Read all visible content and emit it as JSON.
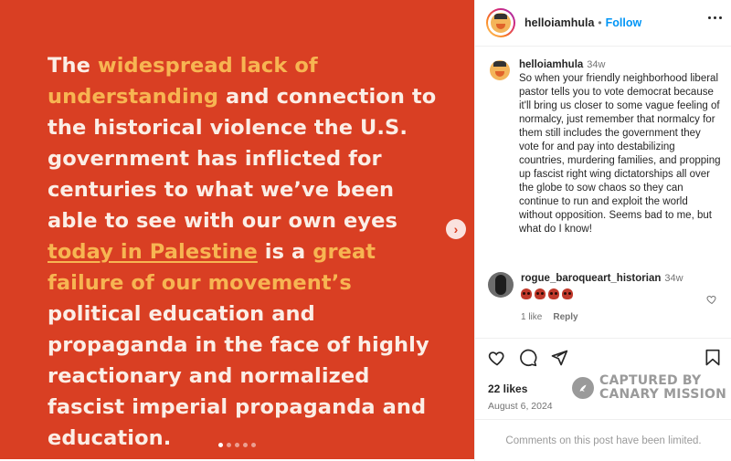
{
  "media": {
    "text": {
      "p1": "The ",
      "p2": "widespread lack of understanding",
      "p3": " and connection to the historical violence the U.S. government has inflicted for centuries to what we’ve been able to see with our own eyes ",
      "p4": "today in Palestine",
      "p5": " is a ",
      "p6": "great failure of our movement’s",
      "p7": " political education and propaganda in the face of highly reactionary and normalized fascist imperial propaganda and education."
    },
    "background_color": "#d93f23",
    "highlight_color": "#f7b552",
    "next_icon": "chevron-right-icon",
    "carousel": {
      "total": 5,
      "active": 1
    }
  },
  "header": {
    "username": "helloiamhula",
    "separator": "•",
    "follow_label": "Follow",
    "more_icon": "more-horizontal-icon"
  },
  "caption": {
    "username": "helloiamhula",
    "time": "34w",
    "text": "So when your friendly neighborhood liberal pastor tells you to vote democrat because it'll bring us closer to some vague feeling of normalcy, just remember that normalcy for them still includes the government they vote for and pay into destabilizing countries, murdering families, and propping up fascist right wing dictatorships all over the globe to sow chaos so they can continue to run and exploit the world without opposition. Seems bad to me, but what do I know!"
  },
  "reply": {
    "username": "rogue_baroqueart_historian",
    "time": "34w",
    "emojis": [
      "skull-emoji",
      "skull-emoji",
      "skull-emoji",
      "skull-emoji"
    ],
    "likes": "1 like",
    "reply_label": "Reply"
  },
  "actions": {
    "icons": [
      "heart-icon",
      "comment-icon",
      "share-icon",
      "bookmark-icon"
    ],
    "likes": "22 likes",
    "date": "August 6, 2024"
  },
  "watermark": {
    "line1": "CAPTURED BY",
    "line2": "CANARY MISSION"
  },
  "footer": {
    "text": "Comments on this post have been limited."
  }
}
